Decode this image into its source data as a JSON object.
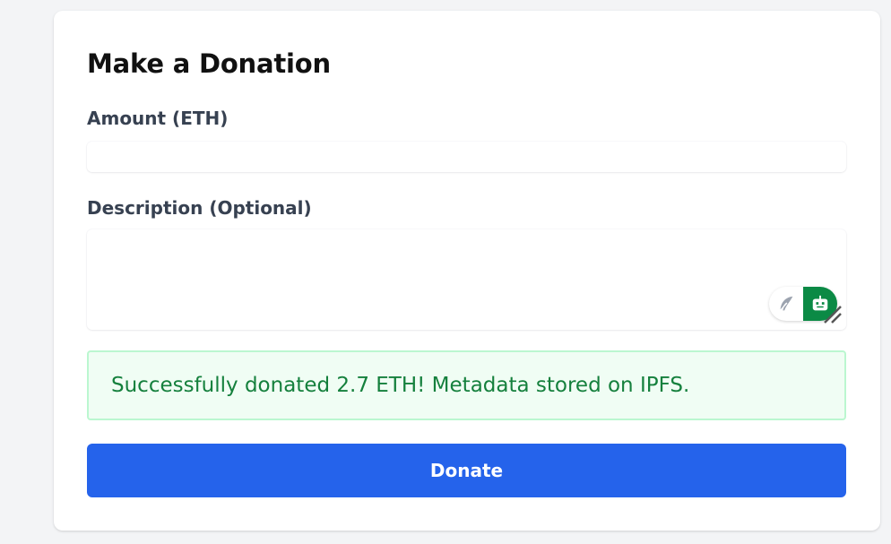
{
  "form": {
    "title": "Make a Donation",
    "amount_label": "Amount (ETH)",
    "amount_value": "",
    "description_label": "Description (Optional)",
    "description_value": ""
  },
  "extension_widget": {
    "left_icon": "feather-icon",
    "right_icon": "robot-icon",
    "accent_color": "#0b8a45"
  },
  "alert": {
    "message": "Successfully donated 2.7 ETH! Metadata stored on IPFS.",
    "type": "success",
    "text_color": "#15803d",
    "background_color": "#f0fdf4",
    "border_color": "#bbf7d0"
  },
  "actions": {
    "donate_label": "Donate",
    "button_color": "#2563eb"
  }
}
